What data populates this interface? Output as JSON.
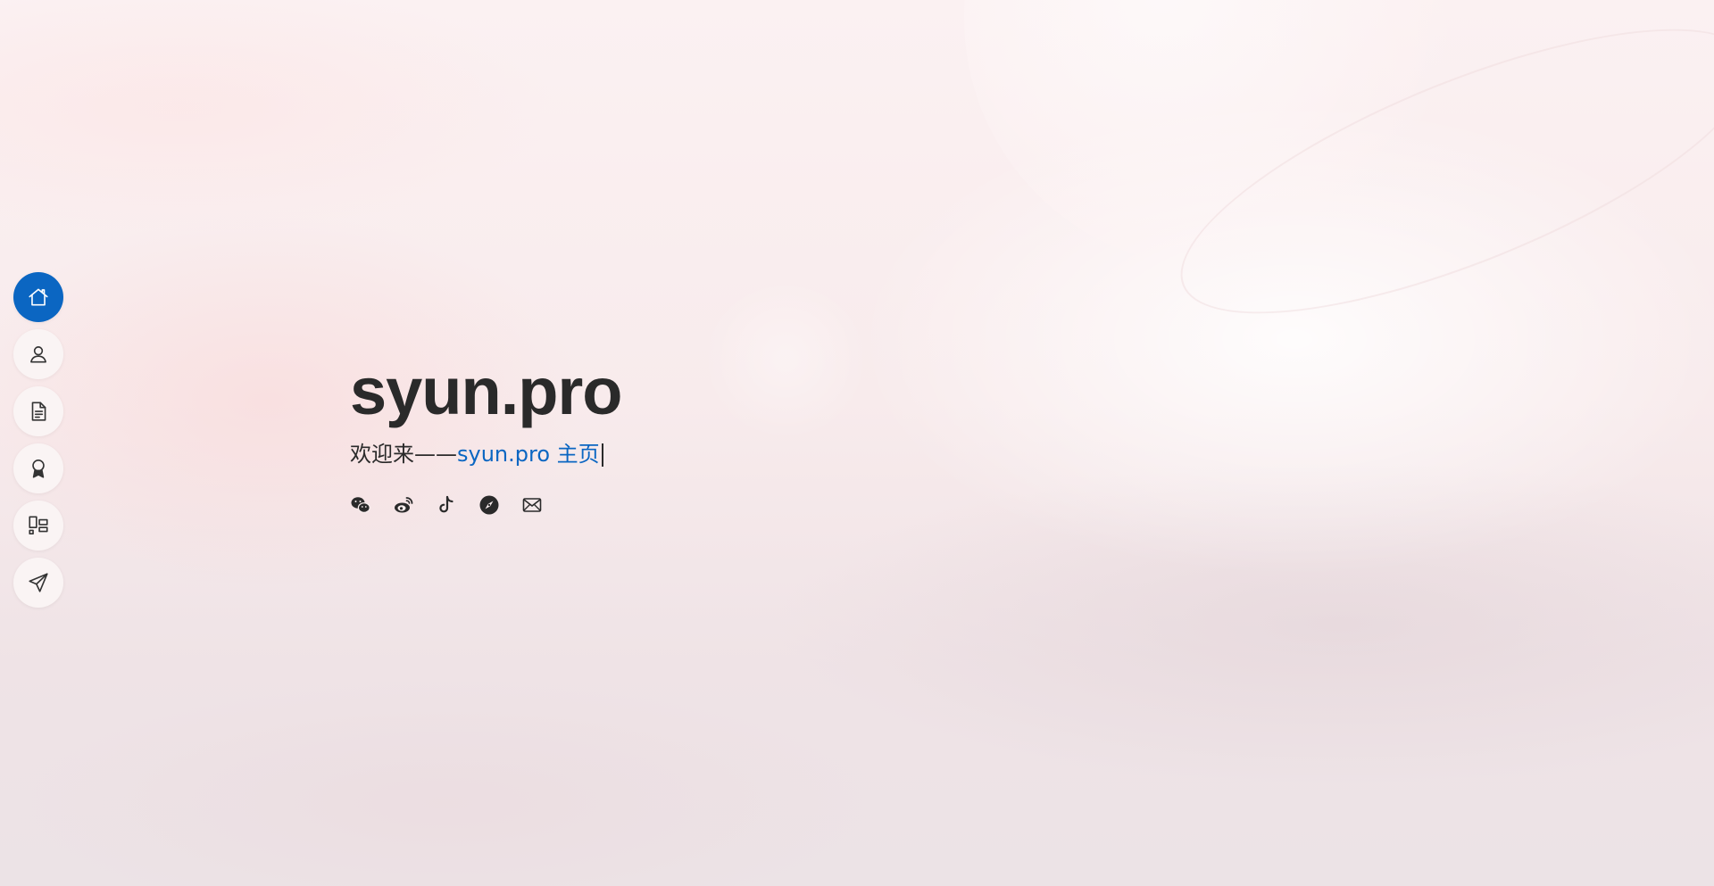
{
  "site": {
    "title": "syun.pro",
    "tagline_prefix": "欢迎来——",
    "tagline_typed": "syun.pro 主页"
  },
  "sidebar": {
    "accent_color": "#0b66c2",
    "items": [
      {
        "id": "home",
        "icon": "home-icon",
        "active": true
      },
      {
        "id": "about",
        "icon": "person-icon",
        "active": false
      },
      {
        "id": "resume",
        "icon": "document-icon",
        "active": false
      },
      {
        "id": "awards",
        "icon": "award-icon",
        "active": false
      },
      {
        "id": "portfolio",
        "icon": "layout-icon",
        "active": false
      },
      {
        "id": "contact",
        "icon": "send-icon",
        "active": false
      }
    ]
  },
  "social": [
    {
      "id": "wechat",
      "icon": "wechat-icon"
    },
    {
      "id": "weibo",
      "icon": "weibo-icon"
    },
    {
      "id": "tiktok",
      "icon": "tiktok-icon"
    },
    {
      "id": "safari",
      "icon": "compass-icon"
    },
    {
      "id": "email",
      "icon": "mail-icon"
    }
  ]
}
